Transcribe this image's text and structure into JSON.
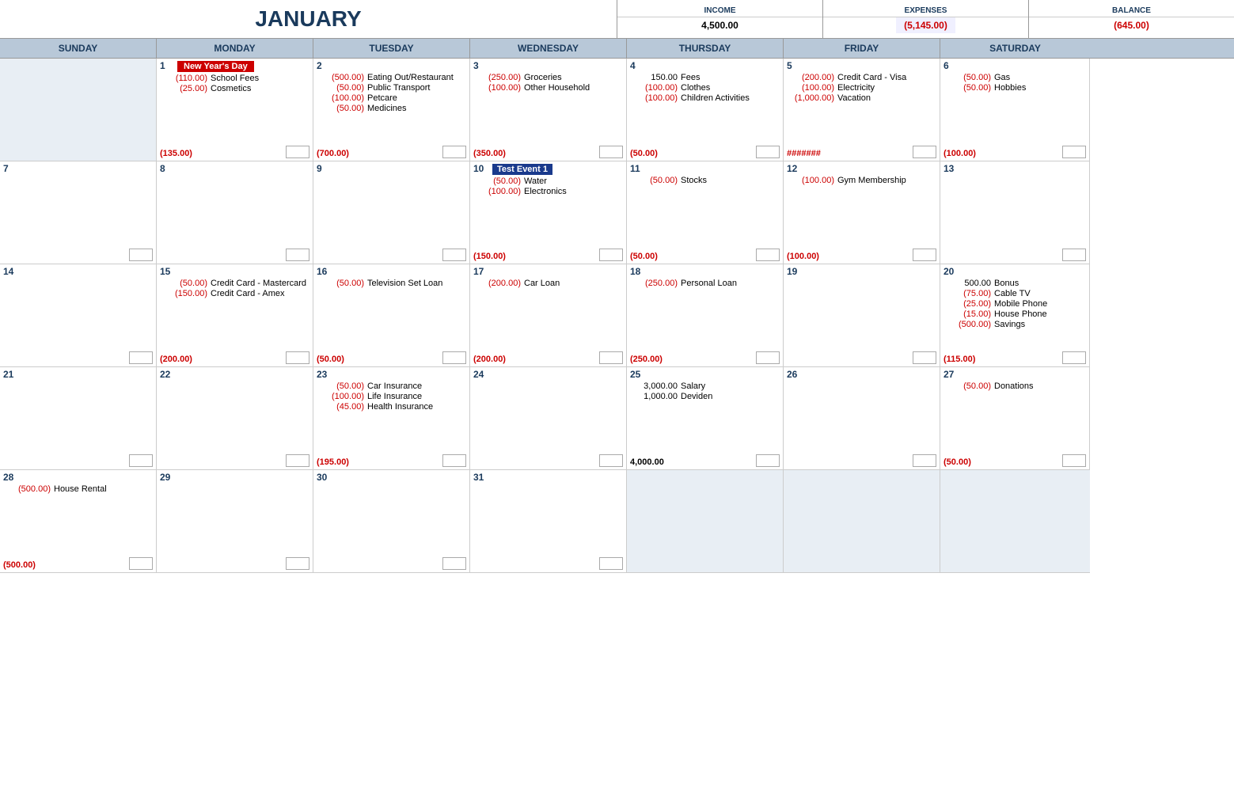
{
  "header": {
    "title": "JANUARY",
    "income_label": "INCOME",
    "expenses_label": "EXPENSES",
    "balance_label": "BALANCE",
    "income_value": "4,500.00",
    "expenses_value": "(5,145.00)",
    "balance_value": "(645.00)"
  },
  "day_headers": [
    "SUNDAY",
    "MONDAY",
    "TUESDAY",
    "WEDNESDAY",
    "THURSDAY",
    "FRIDAY",
    "SATURDAY"
  ],
  "weeks": [
    {
      "days": [
        {
          "num": "",
          "empty": true,
          "entries": [],
          "total": ""
        },
        {
          "num": "1",
          "holiday": "New Year's Day",
          "entries": [
            {
              "amount": "(110.00)",
              "desc": "School Fees",
              "type": "expense"
            },
            {
              "amount": "(25.00)",
              "desc": "Cosmetics",
              "type": "expense"
            }
          ],
          "total": "(135.00)",
          "total_type": "expense"
        },
        {
          "num": "2",
          "entries": [
            {
              "amount": "(500.00)",
              "desc": "Eating Out/Restaurant",
              "type": "expense"
            },
            {
              "amount": "(50.00)",
              "desc": "Public Transport",
              "type": "expense"
            },
            {
              "amount": "(100.00)",
              "desc": "Petcare",
              "type": "expense"
            },
            {
              "amount": "(50.00)",
              "desc": "Medicines",
              "type": "expense"
            }
          ],
          "total": "(700.00)",
          "total_type": "expense"
        },
        {
          "num": "3",
          "entries": [
            {
              "amount": "(250.00)",
              "desc": "Groceries",
              "type": "expense"
            },
            {
              "amount": "(100.00)",
              "desc": "Other Household",
              "type": "expense"
            }
          ],
          "total": "(350.00)",
          "total_type": "expense"
        },
        {
          "num": "4",
          "entries": [
            {
              "amount": "150.00",
              "desc": "Fees",
              "type": "income-amt"
            },
            {
              "amount": "(100.00)",
              "desc": "Clothes",
              "type": "expense"
            },
            {
              "amount": "(100.00)",
              "desc": "Children Activities",
              "type": "expense"
            }
          ],
          "total": "(50.00)",
          "total_type": "expense"
        },
        {
          "num": "5",
          "entries": [
            {
              "amount": "(200.00)",
              "desc": "Credit Card - Visa",
              "type": "expense"
            },
            {
              "amount": "(100.00)",
              "desc": "Electricity",
              "type": "expense"
            },
            {
              "amount": "(1,000.00)",
              "desc": "Vacation",
              "type": "expense"
            }
          ],
          "total": "#######",
          "total_type": "hash"
        },
        {
          "num": "6",
          "entries": [
            {
              "amount": "(50.00)",
              "desc": "Gas",
              "type": "expense"
            },
            {
              "amount": "(50.00)",
              "desc": "Hobbies",
              "type": "expense"
            }
          ],
          "total": "(100.00)",
          "total_type": "expense"
        }
      ]
    },
    {
      "days": [
        {
          "num": "7",
          "entries": [],
          "total": ""
        },
        {
          "num": "8",
          "entries": [],
          "total": ""
        },
        {
          "num": "9",
          "entries": [],
          "total": ""
        },
        {
          "num": "10",
          "event": "Test Event 1",
          "event_color": "blue",
          "entries": [
            {
              "amount": "(50.00)",
              "desc": "Water",
              "type": "expense"
            },
            {
              "amount": "(100.00)",
              "desc": "Electronics",
              "type": "expense"
            }
          ],
          "total": "(150.00)",
          "total_type": "expense"
        },
        {
          "num": "11",
          "entries": [
            {
              "amount": "(50.00)",
              "desc": "Stocks",
              "type": "expense"
            }
          ],
          "total": "(50.00)",
          "total_type": "expense"
        },
        {
          "num": "12",
          "entries": [
            {
              "amount": "(100.00)",
              "desc": "Gym Membership",
              "type": "expense"
            }
          ],
          "total": "(100.00)",
          "total_type": "expense"
        },
        {
          "num": "13",
          "entries": [],
          "total": ""
        }
      ]
    },
    {
      "days": [
        {
          "num": "14",
          "entries": [],
          "total": ""
        },
        {
          "num": "15",
          "entries": [
            {
              "amount": "(50.00)",
              "desc": "Credit Card - Mastercard",
              "type": "expense"
            },
            {
              "amount": "(150.00)",
              "desc": "Credit Card - Amex",
              "type": "expense"
            }
          ],
          "total": "(200.00)",
          "total_type": "expense"
        },
        {
          "num": "16",
          "entries": [
            {
              "amount": "(50.00)",
              "desc": "Television Set Loan",
              "type": "expense"
            }
          ],
          "total": "(50.00)",
          "total_type": "expense"
        },
        {
          "num": "17",
          "entries": [
            {
              "amount": "(200.00)",
              "desc": "Car Loan",
              "type": "expense"
            }
          ],
          "total": "(200.00)",
          "total_type": "expense"
        },
        {
          "num": "18",
          "entries": [
            {
              "amount": "(250.00)",
              "desc": "Personal Loan",
              "type": "expense"
            }
          ],
          "total": "(250.00)",
          "total_type": "expense"
        },
        {
          "num": "19",
          "entries": [],
          "total": ""
        },
        {
          "num": "20",
          "entries": [
            {
              "amount": "500.00",
              "desc": "Bonus",
              "type": "income-amt"
            },
            {
              "amount": "(75.00)",
              "desc": "Cable TV",
              "type": "expense"
            },
            {
              "amount": "(25.00)",
              "desc": "Mobile Phone",
              "type": "expense"
            },
            {
              "amount": "(15.00)",
              "desc": "House Phone",
              "type": "expense"
            },
            {
              "amount": "(500.00)",
              "desc": "Savings",
              "type": "expense"
            }
          ],
          "total": "(115.00)",
          "total_type": "expense"
        }
      ]
    },
    {
      "days": [
        {
          "num": "21",
          "entries": [],
          "total": ""
        },
        {
          "num": "22",
          "entries": [],
          "total": ""
        },
        {
          "num": "23",
          "entries": [
            {
              "amount": "(50.00)",
              "desc": "Car Insurance",
              "type": "expense"
            },
            {
              "amount": "(100.00)",
              "desc": "Life Insurance",
              "type": "expense"
            },
            {
              "amount": "(45.00)",
              "desc": "Health Insurance",
              "type": "expense"
            }
          ],
          "total": "(195.00)",
          "total_type": "expense"
        },
        {
          "num": "24",
          "entries": [],
          "total": ""
        },
        {
          "num": "25",
          "entries": [
            {
              "amount": "3,000.00",
              "desc": "Salary",
              "type": "income-amt"
            },
            {
              "amount": "1,000.00",
              "desc": "Deviden",
              "type": "income-amt"
            }
          ],
          "total": "4,000.00",
          "total_type": "income-total"
        },
        {
          "num": "26",
          "entries": [],
          "total": ""
        },
        {
          "num": "27",
          "entries": [
            {
              "amount": "(50.00)",
              "desc": "Donations",
              "type": "expense"
            }
          ],
          "total": "(50.00)",
          "total_type": "expense"
        }
      ]
    },
    {
      "days": [
        {
          "num": "28",
          "entries": [
            {
              "amount": "(500.00)",
              "desc": "House Rental",
              "type": "expense"
            }
          ],
          "total": "(500.00)",
          "total_type": "expense"
        },
        {
          "num": "29",
          "entries": [],
          "total": ""
        },
        {
          "num": "30",
          "entries": [],
          "total": ""
        },
        {
          "num": "31",
          "entries": [],
          "total": ""
        },
        {
          "num": "",
          "empty": true,
          "entries": [],
          "total": ""
        },
        {
          "num": "",
          "empty": true,
          "entries": [],
          "total": ""
        },
        {
          "num": "",
          "empty": true,
          "entries": [],
          "total": ""
        }
      ]
    }
  ]
}
